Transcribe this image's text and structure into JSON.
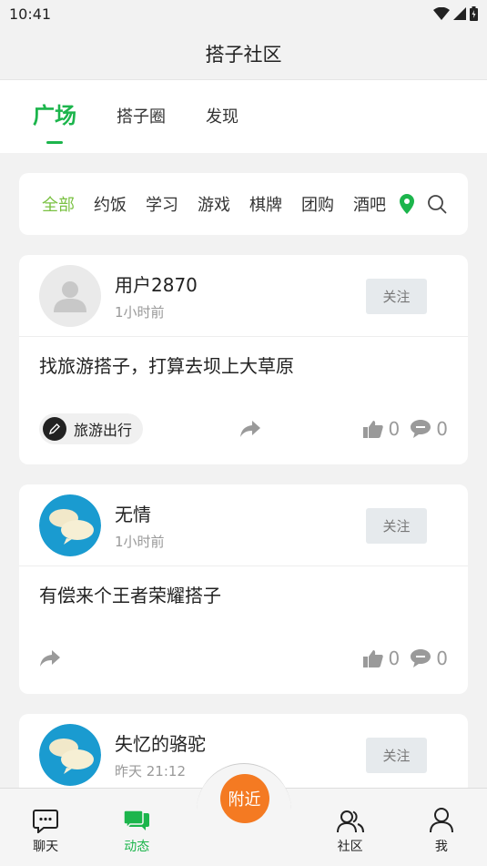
{
  "status": {
    "time": "10:41"
  },
  "header": {
    "title": "搭子社区"
  },
  "tabs": [
    {
      "label": "广场",
      "active": true
    },
    {
      "label": "搭子圈",
      "active": false
    },
    {
      "label": "发现",
      "active": false
    }
  ],
  "filter": {
    "categories": [
      "全部",
      "约饭",
      "学习",
      "游戏",
      "棋牌",
      "团购",
      "酒吧"
    ],
    "active_index": 0,
    "location_icon": "location-pin-icon",
    "search_icon": "search-icon",
    "active_color": "#7ac142",
    "pin_color": "#1cb54c"
  },
  "posts": [
    {
      "user": "用户2870",
      "time": "1小时前",
      "follow_label": "关注",
      "content": "找旅游搭子，打算去坝上大草原",
      "tag": "旅游出行",
      "likes": "0",
      "comments": "0",
      "avatar": "default-avatar"
    },
    {
      "user": "无情",
      "time": "1小时前",
      "follow_label": "关注",
      "content": "有偿来个王者荣耀搭子",
      "likes": "0",
      "comments": "0",
      "avatar": "chat-bubble-avatar"
    },
    {
      "user": "失忆的骆驼",
      "time": "昨天 21:12",
      "follow_label": "关注",
      "avatar": "chat-bubble-avatar"
    }
  ],
  "bottom_nav": {
    "items": [
      {
        "label": "聊天",
        "icon": "chat-icon",
        "active": false
      },
      {
        "label": "动态",
        "icon": "moments-icon",
        "active": true
      },
      {
        "label": "社区",
        "icon": "community-icon",
        "active": false
      },
      {
        "label": "我",
        "icon": "profile-icon",
        "active": false
      }
    ],
    "center_label": "附近",
    "center_color": "#f47a22",
    "active_color": "#1cb54c"
  }
}
